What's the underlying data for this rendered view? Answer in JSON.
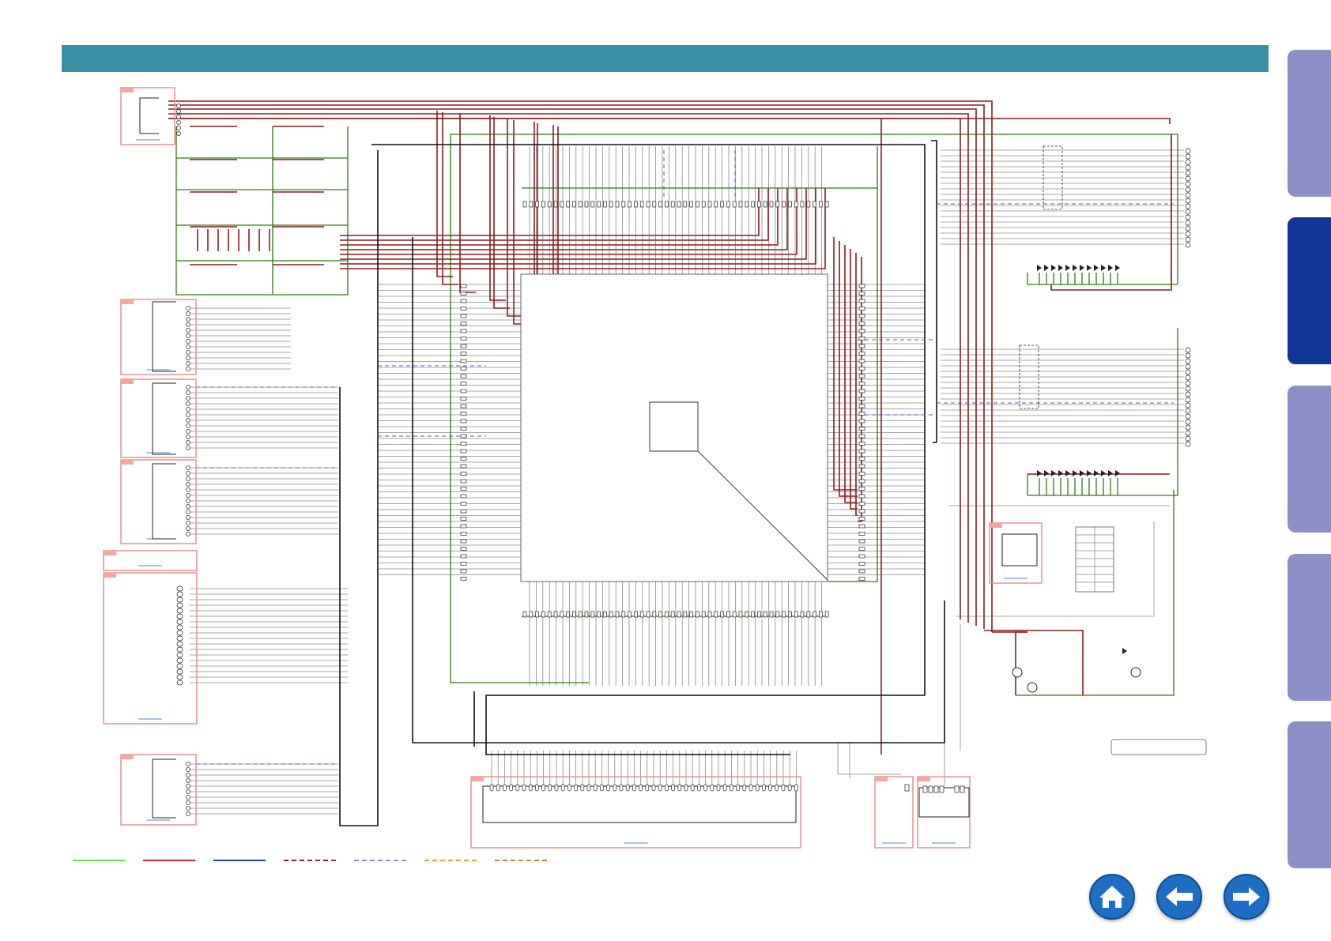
{
  "colors": {
    "title_bar": "#3a8fa5",
    "tab_light": "#8f8fc8",
    "tab_active": "#12359a",
    "nav_button": "#1e6fc4",
    "wire_green": "#2f7a10",
    "wire_red": "#8b1c1c",
    "wire_black": "#111111",
    "wire_gray": "#8a8a8a",
    "wire_blue_dash": "#5555cc",
    "connector_box": "#e89090"
  },
  "side_tabs": [
    {
      "state": "inactive"
    },
    {
      "state": "active"
    },
    {
      "state": "inactive"
    },
    {
      "state": "inactive"
    },
    {
      "state": "inactive"
    }
  ],
  "legend": [
    {
      "style": "solid",
      "color": "#6ee04a"
    },
    {
      "style": "solid",
      "color": "#d02a2a"
    },
    {
      "style": "solid",
      "color": "#1f3fa8"
    },
    {
      "style": "dashed",
      "color": "#a02020"
    },
    {
      "style": "dashed",
      "color": "#8a8ae0"
    },
    {
      "style": "dashed",
      "color": "#e0a040"
    },
    {
      "style": "dashed",
      "color": "#d08030"
    }
  ],
  "nav": {
    "home_icon": "home-icon",
    "back_icon": "arrow-left-icon",
    "forward_icon": "arrow-right-icon"
  }
}
